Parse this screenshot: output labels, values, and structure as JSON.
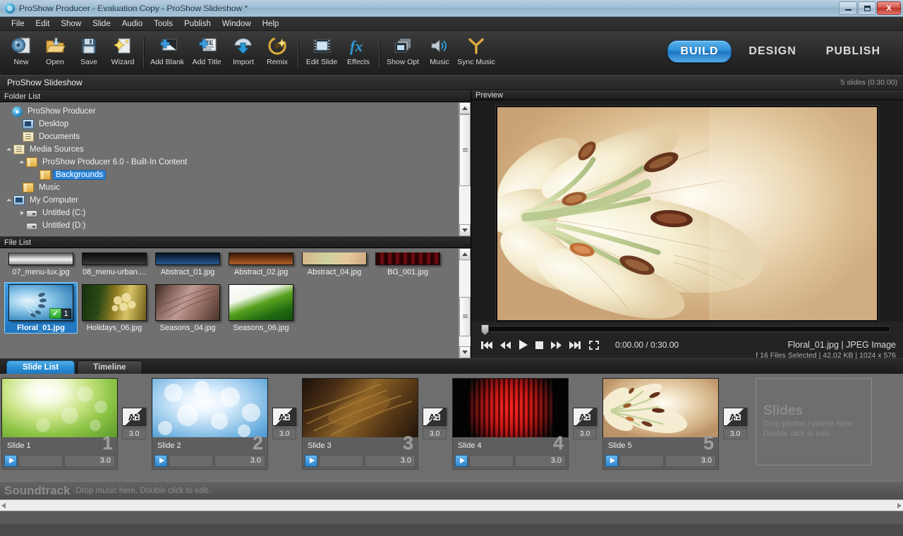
{
  "window": {
    "title": "ProShow Producer - Evaluation Copy - ProShow Slideshow *",
    "minimize_label": "Minimize",
    "maximize_label": "Restore",
    "close_label": "X"
  },
  "menu": [
    "File",
    "Edit",
    "Show",
    "Slide",
    "Audio",
    "Tools",
    "Publish",
    "Window",
    "Help"
  ],
  "toolbar": {
    "tools": [
      {
        "label": "New",
        "icon": "new-show-icon"
      },
      {
        "label": "Open",
        "icon": "open-folder-icon"
      },
      {
        "label": "Save",
        "icon": "save-disk-icon"
      },
      {
        "label": "Wizard",
        "icon": "wizard-wand-icon"
      },
      {
        "label": "Add Blank",
        "icon": "add-blank-slide-icon"
      },
      {
        "label": "Add Title",
        "icon": "add-title-slide-icon"
      },
      {
        "label": "Import",
        "icon": "import-arrow-icon"
      },
      {
        "label": "Remix",
        "icon": "remix-icon"
      },
      {
        "label": "Edit Slide",
        "icon": "edit-slide-icon"
      },
      {
        "label": "Effects",
        "icon": "effects-fx-icon"
      },
      {
        "label": "Show Opt",
        "icon": "show-options-icon"
      },
      {
        "label": "Music",
        "icon": "music-speaker-icon"
      },
      {
        "label": "Sync Music",
        "icon": "sync-music-icon"
      }
    ],
    "modes": [
      {
        "label": "BUILD",
        "active": true
      },
      {
        "label": "DESIGN",
        "active": false
      },
      {
        "label": "PUBLISH",
        "active": false
      }
    ]
  },
  "showbar": {
    "show_name": "ProShow Slideshow",
    "slide_count": "5 slides (0:30.00)"
  },
  "folder_list": {
    "header": "Folder List",
    "items": [
      {
        "label": "ProShow Producer",
        "depth": 0,
        "icon": "proshow-disc-icon",
        "twisty": "none",
        "selected": false
      },
      {
        "label": "Desktop",
        "depth": 1,
        "icon": "desktop-icon",
        "twisty": "none",
        "selected": false
      },
      {
        "label": "Documents",
        "depth": 1,
        "icon": "documents-icon",
        "twisty": "none",
        "selected": false
      },
      {
        "label": "Media Sources",
        "depth": 1,
        "icon": "media-sources-folder-icon",
        "twisty": "open",
        "selected": false
      },
      {
        "label": "ProShow Producer 6.0 - Built-In Content",
        "depth": 2,
        "icon": "folder-icon",
        "twisty": "open",
        "selected": false
      },
      {
        "label": "Backgrounds",
        "depth": 3,
        "icon": "folder-icon",
        "twisty": "none",
        "selected": true
      },
      {
        "label": "Music",
        "depth": 1,
        "icon": "folder-icon",
        "twisty": "none",
        "selected": false
      },
      {
        "label": "My Computer",
        "depth": 1,
        "icon": "my-computer-icon",
        "twisty": "open",
        "selected": false
      },
      {
        "label": "Untitled (C:)",
        "depth": 2,
        "icon": "drive-icon",
        "twisty": "closed",
        "selected": false
      },
      {
        "label": "Untitled (D:)",
        "depth": 2,
        "icon": "drive-icon",
        "twisty": "none",
        "selected": false
      }
    ]
  },
  "file_list": {
    "header": "File List",
    "top_row": [
      {
        "name": "07_menu-lux.jpg"
      },
      {
        "name": "08_menu-urban...."
      },
      {
        "name": "Abstract_01.jpg"
      },
      {
        "name": "Abstract_02.jpg"
      },
      {
        "name": "Abstract_04.jpg"
      },
      {
        "name": "BG_001.jpg"
      }
    ],
    "bottom_row": [
      {
        "name": "Floral_01.jpg",
        "selected": true,
        "use_count": "1"
      },
      {
        "name": "Holidays_06.jpg",
        "selected": false,
        "use_count": ""
      },
      {
        "name": "Seasons_04.jpg",
        "selected": false,
        "use_count": ""
      },
      {
        "name": "Seasons_06.jpg",
        "selected": false,
        "use_count": ""
      }
    ]
  },
  "preview": {
    "header": "Preview",
    "transport": [
      {
        "name": "skip-start-icon"
      },
      {
        "name": "rewind-icon"
      },
      {
        "name": "play-icon"
      },
      {
        "name": "stop-icon"
      },
      {
        "name": "fast-forward-icon"
      },
      {
        "name": "skip-end-icon"
      },
      {
        "name": "fullscreen-icon"
      }
    ],
    "time": "0:00.00 / 0:30.00",
    "meta_line1": "Floral_01.jpg | JPEG Image",
    "meta_line2": "f 16 Files Selected |  42.02 KB  |  1024 x 576"
  },
  "tabs": [
    {
      "label": "Slide List",
      "active": true
    },
    {
      "label": "Timeline",
      "active": false
    }
  ],
  "slides": [
    {
      "name": "Slide 1",
      "number": "1",
      "duration": "3.0",
      "transition_duration": "3.0"
    },
    {
      "name": "Slide 2",
      "number": "2",
      "duration": "3.0",
      "transition_duration": "3.0"
    },
    {
      "name": "Slide 3",
      "number": "3",
      "duration": "3.0",
      "transition_duration": "3.0"
    },
    {
      "name": "Slide 4",
      "number": "4",
      "duration": "3.0",
      "transition_duration": "3.0"
    },
    {
      "name": "Slide 5",
      "number": "5",
      "duration": "3.0",
      "transition_duration": "3.0"
    }
  ],
  "dropzone": {
    "title": "Slides",
    "line1": "Drop photos / videos here.",
    "line2": "Double click to edit."
  },
  "soundtrack": {
    "title": "Soundtrack",
    "hint": "Drop music here.  Double click to edit."
  },
  "colors": {
    "accent_blue": "#2d8fd8",
    "selection_blue": "#2b84d8",
    "panel_gray": "#707070",
    "toolbar_dark": "#272727"
  }
}
